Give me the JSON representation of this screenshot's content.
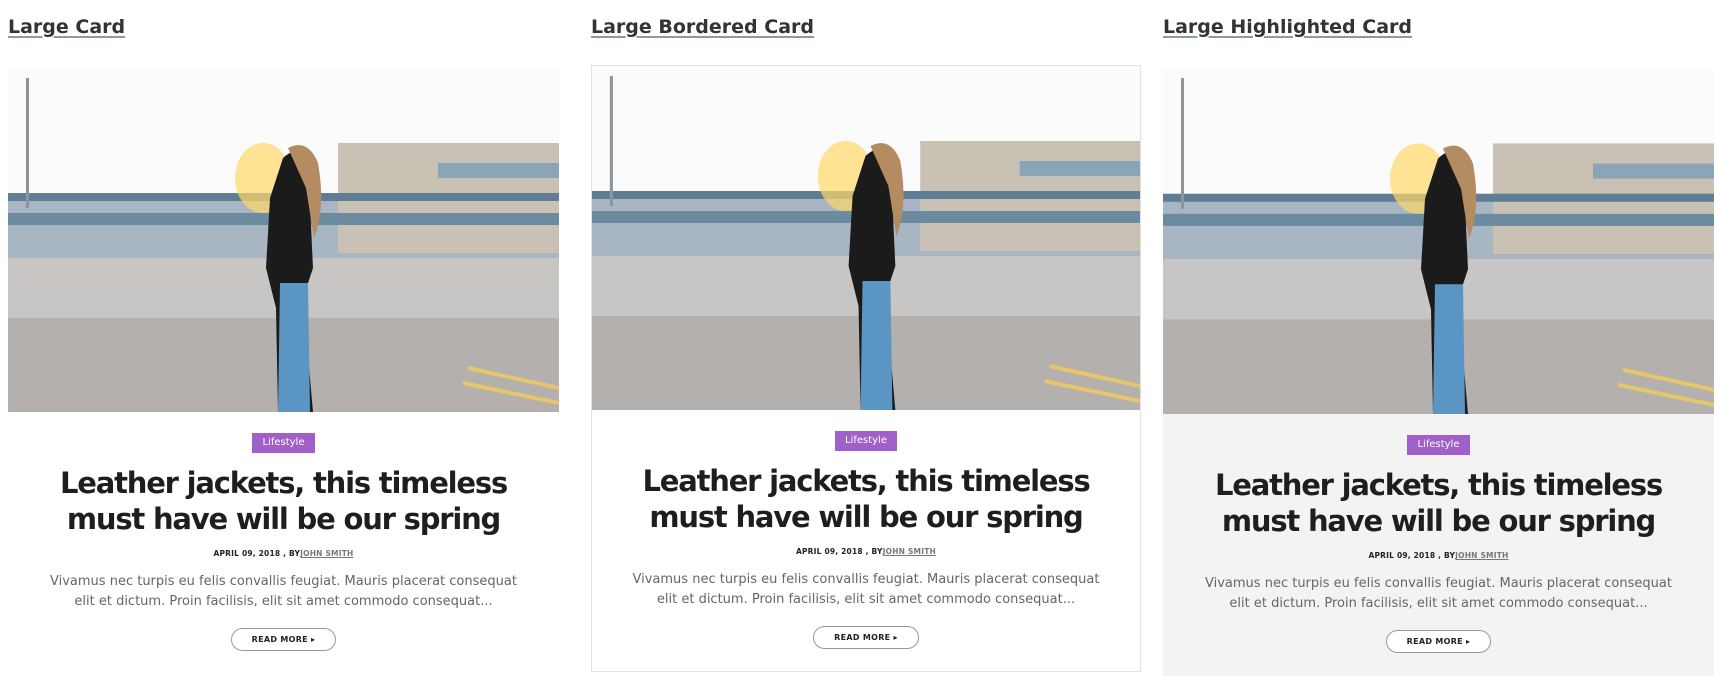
{
  "sections": [
    {
      "title": "Large Card",
      "card": {
        "category": "Lifestyle",
        "headline": "Leather jackets, this timeless must have will be our spring",
        "date": "APRIL 09, 2018 , BY",
        "author": "JOHN SMITH",
        "excerpt": "Vivamus nec turpis eu felis convallis feugiat. Mauris placerat consequat elit et dictum. Proin facilisis, elit sit amet commodo consequat...",
        "read_more": "READ MORE"
      }
    },
    {
      "title": "Large Bordered Card",
      "card": {
        "category": "Lifestyle",
        "headline": "Leather jackets, this timeless must have will be our spring",
        "date": "APRIL 09, 2018 , BY",
        "author": "JOHN SMITH",
        "excerpt": "Vivamus nec turpis eu felis convallis feugiat. Mauris placerat consequat elit et dictum. Proin facilisis, elit sit amet commodo consequat...",
        "read_more": "READ MORE"
      }
    },
    {
      "title": "Large Highlighted Card",
      "card": {
        "category": "Lifestyle",
        "headline": "Leather jackets, this timeless must have will be our spring",
        "date": "APRIL 09, 2018 , BY",
        "author": "JOHN SMITH",
        "excerpt": "Vivamus nec turpis eu felis convallis feugiat. Mauris placerat consequat elit et dictum. Proin facilisis, elit sit amet commodo consequat...",
        "read_more": "READ MORE"
      }
    }
  ],
  "colors": {
    "badge": "#a060c8",
    "highlight_bg": "#f3f3f3",
    "border": "#e2e2e2"
  },
  "icons": {
    "read_more": "caret-right-icon"
  }
}
